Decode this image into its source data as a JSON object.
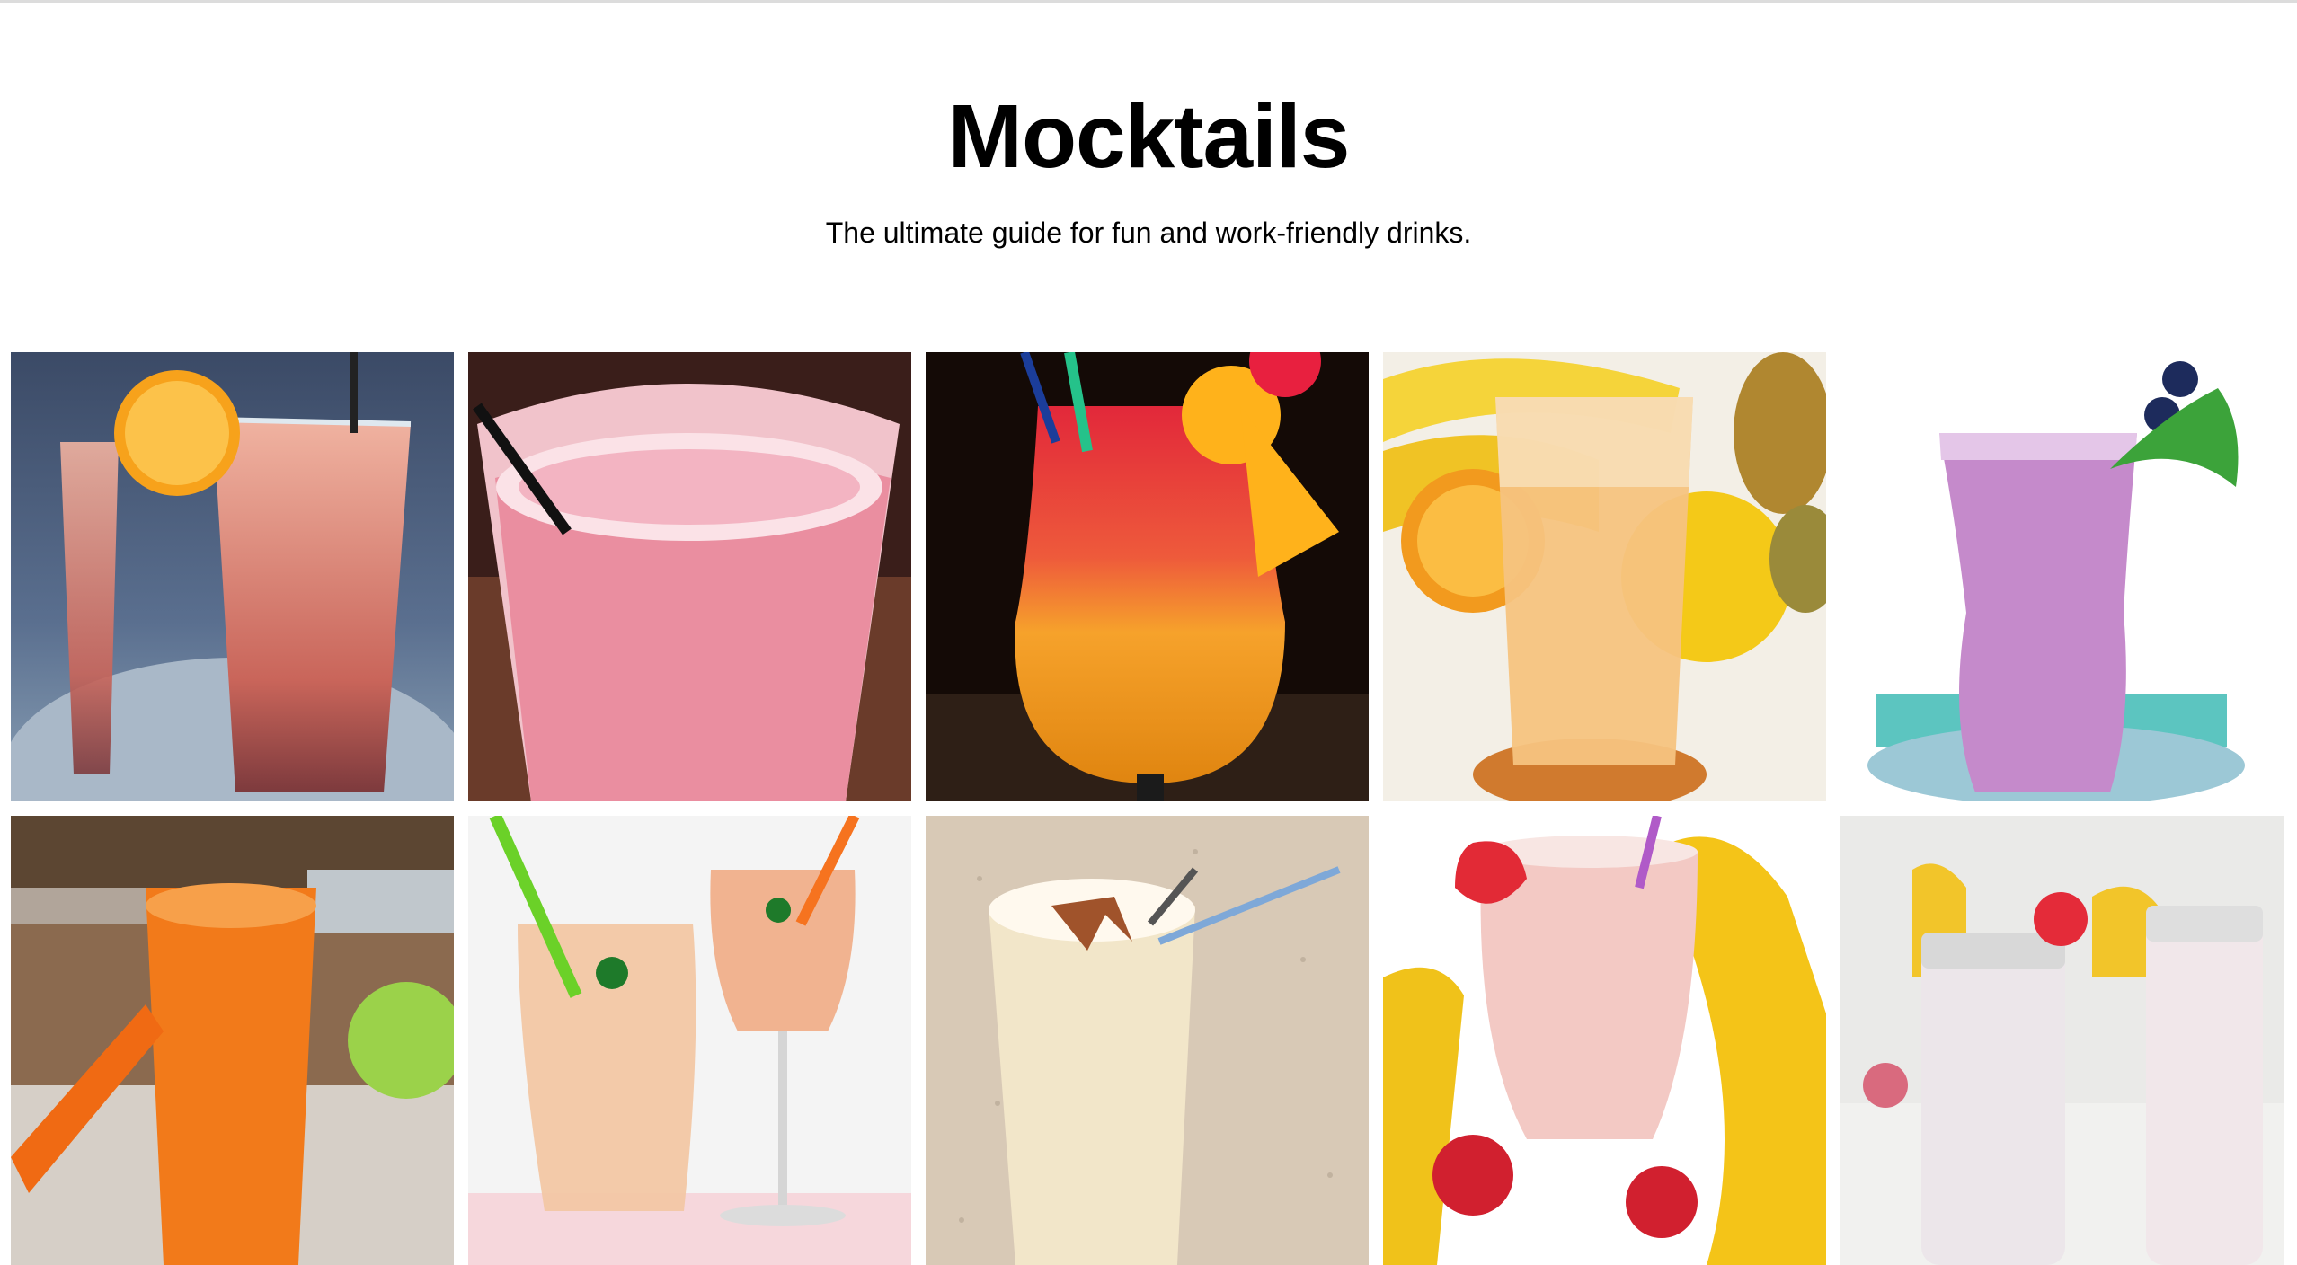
{
  "page": {
    "title": "Mocktails",
    "subtitle": "The ultimate guide for fun and work-friendly drinks."
  },
  "gallery": [
    {
      "name": "pink-lemonade-orange-glasses"
    },
    {
      "name": "strawberry-frozen-drink"
    },
    {
      "name": "sunrise-mocktail-orange-slice"
    },
    {
      "name": "orange-juice-with-fruits"
    },
    {
      "name": "berry-smoothie-mint-blueberries"
    },
    {
      "name": "carrot-juice-with-apple"
    },
    {
      "name": "peach-smoothies-two-glasses"
    },
    {
      "name": "cinnamon-shake-straw"
    },
    {
      "name": "strawberry-banana-smoothie"
    },
    {
      "name": "jar-smoothies-strawberry"
    }
  ],
  "colors": {
    "background": "#ffffff",
    "title": "#000000",
    "rule": "#dcdcdc"
  }
}
